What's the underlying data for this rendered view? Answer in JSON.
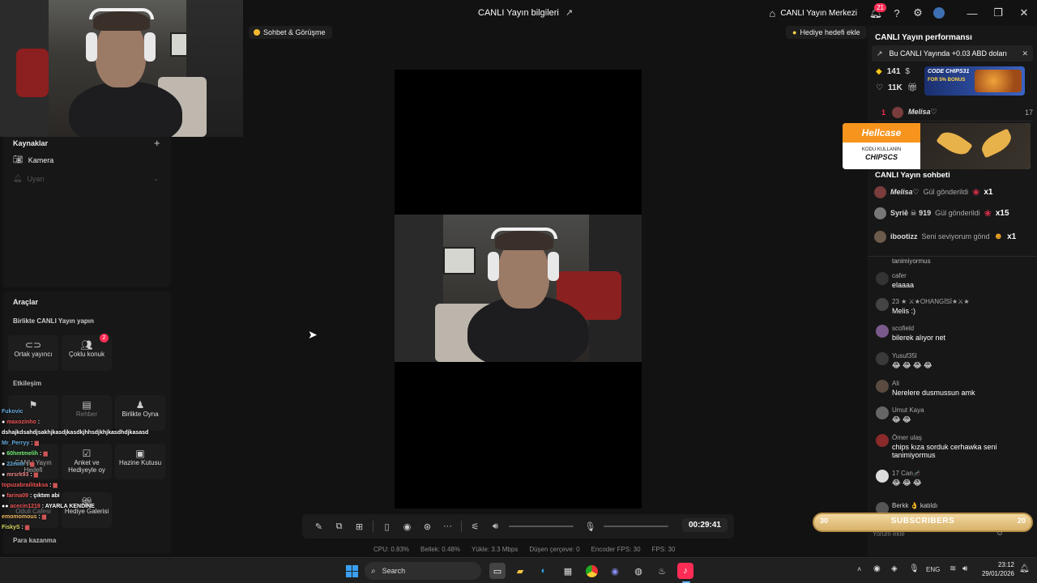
{
  "header": {
    "title": "CANLI Yayın bilgileri",
    "live_center": "CANLI Yayın Merkezi",
    "notification_count": "21"
  },
  "left": {
    "sources_title": "Kaynaklar",
    "sources": [
      "Kamera",
      "Uyarı"
    ],
    "tools_title": "Araçlar",
    "cohost_title": "Birlikte CANLI Yayın yapın",
    "cohost_buttons": [
      "Ortak yayıncı",
      "Çoklu konuk"
    ],
    "multi_guest_badge": "2",
    "interaction_title": "Etkileşim",
    "interaction_buttons": [
      "Rehber",
      "Birlikte Oyna",
      "CANLI Yayın Hedefi",
      "Anket ve Hediyeyle oy",
      "Hazine Kutusu",
      "Oduli Cafesi",
      "Hediye Galerisi"
    ],
    "earn_title": "Para kazanma"
  },
  "left_chat": [
    {
      "user": "Fukovic",
      "text": ""
    },
    {
      "user": "maxozinho",
      "text": ""
    },
    {
      "user": "",
      "text": "dshajkdsahdjsakhjkasdjkasdkjhhsdjkhjkasdhdjkasasd"
    },
    {
      "user": "Mr_Perryy",
      "text": ""
    },
    {
      "user": "60hmtmelih",
      "text": ""
    },
    {
      "user": "22emlr",
      "text": ""
    },
    {
      "user": "mrsrk93",
      "text": ""
    },
    {
      "user": "topuzabrailitaksa",
      "text": ""
    },
    {
      "user": "farina09",
      "text": "çıktım abi"
    },
    {
      "user": "acecin1219",
      "text": "AYARLA KENDİNE"
    },
    {
      "user": "emomomous",
      "text": ""
    },
    {
      "user": "FiskyS",
      "text": ""
    }
  ],
  "stage": {
    "chat_call": "Sohbet & Görüşme",
    "gift_goal": "Hediye hedefi ekle",
    "timer": "00:29:41"
  },
  "stats": {
    "cpu": "CPU: 0.83%",
    "memory": "Bellek: 0.48%",
    "upload": "Yükle: 3.3 Mbps",
    "dropped": "Düşen çerçeve: 0",
    "encoder_fps": "Encoder FPS: 30",
    "fps": "FPS: 30"
  },
  "right": {
    "perf_title": "CANLI Yayın performansı",
    "earnings": "Bu CANLI Yayında +0.03 ABD doları",
    "diamonds": "141",
    "likes": "11K",
    "rank_num": "1",
    "rank_user": "Melisa♡",
    "rank_value": "17",
    "ad_code": "CODE CHIPS31",
    "ad_bonus": "FOR 5% BONUS",
    "hellcase_title": "Hellcase",
    "hellcase_code_label": "KODU KULLANIN",
    "hellcase_code": "CHIPSCS",
    "chat_title": "CANLI Yayın sohbeti",
    "gifts": [
      {
        "user": "Melisa♡",
        "text": "Gül gönderildi",
        "count": "x1"
      },
      {
        "user": "Syriē ☠ 919",
        "text": "Gül gönderildi",
        "count": "x15"
      },
      {
        "user": "ibootizz",
        "text": "Seni seviyorum gönd",
        "count": "x1"
      }
    ],
    "chat": [
      {
        "user": "",
        "text": "tanimiyormus"
      },
      {
        "user": "cafer",
        "text": "elaaaa"
      },
      {
        "user": "23  ★ ⚔★OHANGİSİ★⚔★",
        "text": "Melis :)"
      },
      {
        "user": "scofield",
        "text": "bilerek alıyor net"
      },
      {
        "user": "Yusuf35l",
        "text": "😂 😂 😂 😂"
      },
      {
        "user": "Ali",
        "text": "Nerelere dusmussun amk"
      },
      {
        "user": "Umut Kaya",
        "text": "😂 😂"
      },
      {
        "user": "Ömer ulaş",
        "text": "chips kıza sorduk cerhawka seni tanimiyormus"
      },
      {
        "user": "17  Can🦟",
        "text": "😂 😂 😂"
      },
      {
        "user": "Berkk 👌 katıldı",
        "text": ""
      }
    ],
    "comment_placeholder": "Yorum ekle",
    "subs_left": "30",
    "subs_label": "SUBSCRIBERS",
    "subs_right": "20"
  },
  "taskbar": {
    "search": "Search",
    "lang": "ENG",
    "time": "23:12",
    "date": "29/01/2026"
  }
}
